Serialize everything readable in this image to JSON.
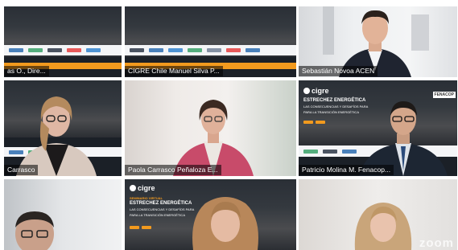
{
  "participants": [
    {
      "name": "as O., Dire..."
    },
    {
      "name": "CIGRE Chile Manuel Silva P..."
    },
    {
      "name": "Sebastián Novoa ACEN"
    },
    {
      "name": "Carrasco"
    },
    {
      "name": "Paola Carrasco Peñaloza E..."
    },
    {
      "name": "Patricio Molina M. Fenacop..."
    },
    {
      "name": ""
    },
    {
      "name": ""
    },
    {
      "name": ""
    }
  ],
  "background": {
    "brand": "cigre",
    "title_line1": "ESTRECHEZ ENERGÉTICA",
    "title_line2": "LAS CONSECUENCIAS Y DESAFÍOS PARA",
    "title_line3": "PARA LA TRANSICIÓN ENERGÉTICA",
    "tag": "SEMINARIO VIRTUAL",
    "sponsor_logo": "FENACOP"
  },
  "watermark": "zoom",
  "colors": {
    "accent": "#f29a1e",
    "speaking": "#39d23c"
  }
}
